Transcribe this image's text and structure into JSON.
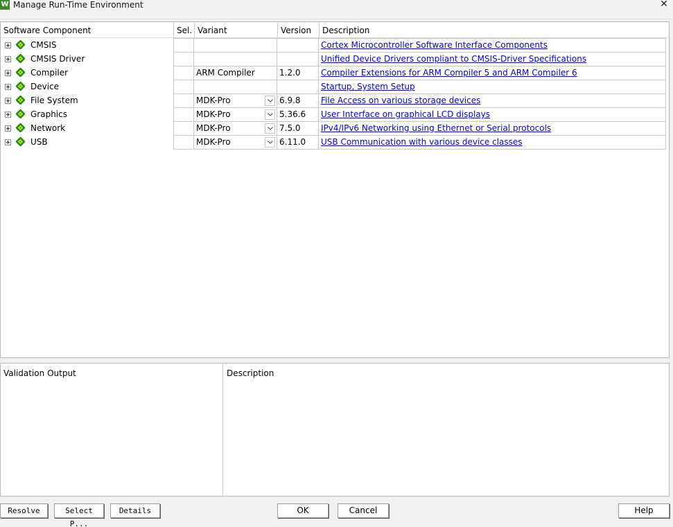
{
  "window": {
    "title": "Manage Run-Time Environment",
    "icon": "keil-uvision-icon",
    "close_icon": "close-icon"
  },
  "columns": {
    "component": "Software Component",
    "sel": "Sel.",
    "variant": "Variant",
    "version": "Version",
    "description": "Description"
  },
  "rows": [
    {
      "name": "CMSIS",
      "variant": "",
      "has_dropdown": false,
      "version": "",
      "description": "Cortex Microcontroller Software Interface Components"
    },
    {
      "name": "CMSIS Driver",
      "variant": "",
      "has_dropdown": false,
      "version": "",
      "description": "Unified Device Drivers compliant to CMSIS-Driver Specifications"
    },
    {
      "name": "Compiler",
      "variant": "ARM Compiler",
      "has_dropdown": false,
      "version": "1.2.0",
      "description": "Compiler Extensions for ARM Compiler 5 and ARM Compiler 6"
    },
    {
      "name": "Device",
      "variant": "",
      "has_dropdown": false,
      "version": "",
      "description": "Startup, System Setup"
    },
    {
      "name": "File System",
      "variant": "MDK-Pro",
      "has_dropdown": true,
      "version": "6.9.8",
      "description": "File Access on various storage devices"
    },
    {
      "name": "Graphics",
      "variant": "MDK-Pro",
      "has_dropdown": true,
      "version": "5.36.6",
      "description": "User Interface on graphical LCD displays"
    },
    {
      "name": "Network",
      "variant": "MDK-Pro",
      "has_dropdown": true,
      "version": "7.5.0",
      "description": "IPv4/IPv6 Networking using Ethernet or Serial protocols"
    },
    {
      "name": "USB",
      "variant": "MDK-Pro",
      "has_dropdown": true,
      "version": "6.11.0",
      "description": "USB Communication with various device classes"
    }
  ],
  "validation": {
    "output_header": "Validation Output",
    "description_header": "Description"
  },
  "buttons": {
    "resolve": "Resolve",
    "select_packs": "Select P...",
    "details": "Details",
    "ok": "OK",
    "cancel": "Cancel",
    "help": "Help"
  },
  "colors": {
    "link": "#0000ee",
    "component_icon": "#1aa21a",
    "component_icon_accent": "#f2e000"
  }
}
